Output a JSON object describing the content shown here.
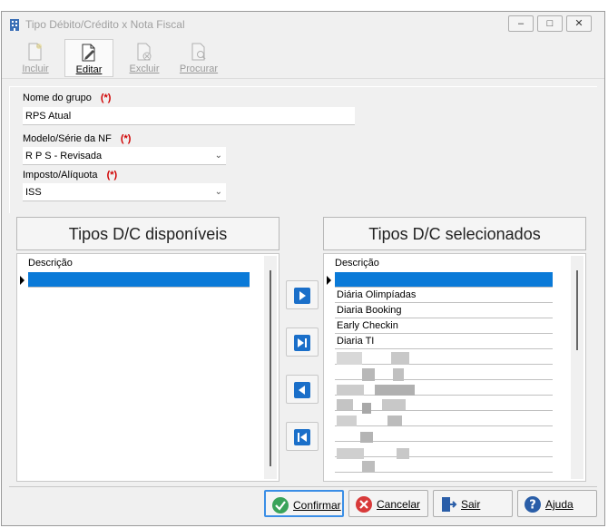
{
  "window": {
    "title": "Tipo Débito/Crédito  x Nota Fiscal",
    "minimize_label": "‒",
    "maximize_label": "□",
    "close_label": "✕"
  },
  "toolbar": {
    "incluir": "Incluir",
    "editar": "Editar",
    "excluir": "Excluir",
    "procurar": "Procurar"
  },
  "form": {
    "required_marker": "(*)",
    "nome_grupo_label": "Nome do grupo",
    "nome_grupo_value": "RPS Atual",
    "modelo_label": "Modelo/Série da NF",
    "modelo_value": "R P S - Revisada",
    "imposto_label": "Imposto/Alíquota",
    "imposto_value": "ISS"
  },
  "available": {
    "title": "Tipos D/C disponíveis",
    "column_header": "Descrição"
  },
  "selected": {
    "title": "Tipos D/C selecionados",
    "column_header": "Descrição",
    "rows": [
      "Diária Olimpíadas",
      "Diaria Booking",
      "Early Checkin",
      "Diaria TI"
    ]
  },
  "buttons": {
    "confirmar": "Confirmar",
    "cancelar": "Cancelar",
    "sair": "Sair",
    "ajuda": "Ajuda"
  },
  "colors": {
    "selection": "#0a7ad8",
    "required": "#d00000",
    "move_arrow": "#1a6fc9"
  }
}
